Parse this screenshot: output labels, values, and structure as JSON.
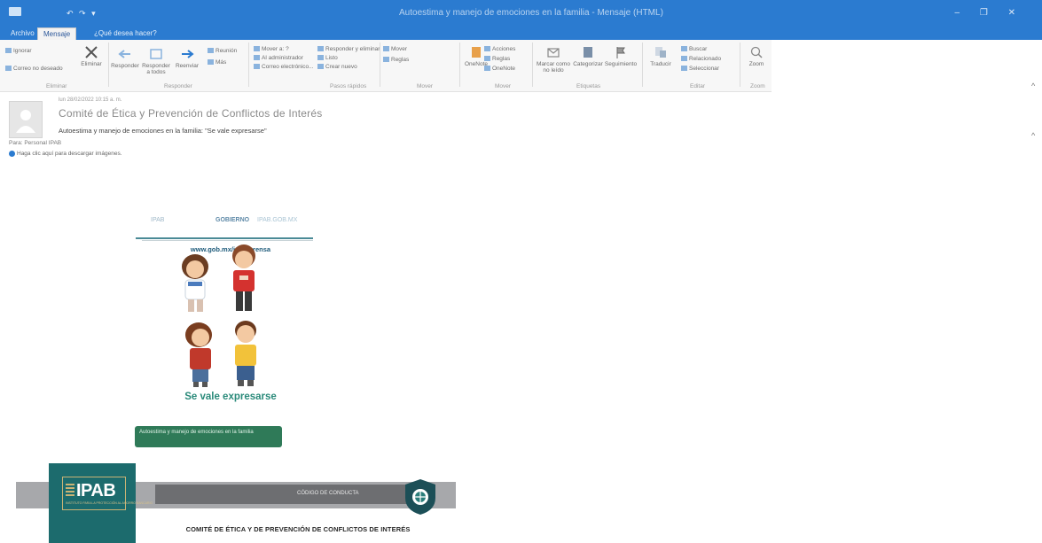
{
  "window": {
    "title": "Autoestima y manejo de emociones en la familia - Mensaje (HTML)",
    "controls": "–  ❐  ✕"
  },
  "tabs": [
    {
      "label": "Archivo"
    },
    {
      "label": "Mensaje"
    },
    {
      "label": "¿Qué desea hacer?"
    }
  ],
  "ribbon": {
    "groups": [
      {
        "label": "Eliminar"
      },
      {
        "label": "Responder"
      },
      {
        "label": "Pasos rápidos"
      },
      {
        "label": "Mover"
      },
      {
        "label": "Etiquetas"
      },
      {
        "label": "Editar"
      },
      {
        "label": "Zoom"
      }
    ],
    "buttons": {
      "ignore": "Ignorar",
      "junk": "Correo no deseado",
      "delete": "Eliminar",
      "reply": "Responder",
      "reply_all": "Responder a todos",
      "forward": "Reenviar",
      "meeting": "Reunión",
      "more": "Más",
      "move_to": "Mover a: ?",
      "to_manager": "Al administrador",
      "team_email": "Correo electrónico...",
      "reply_delete": "Responder y eliminar",
      "done": "Listo",
      "create_new": "Crear nuevo",
      "move": "Mover",
      "rules": "Reglas",
      "onenote": "OneNote",
      "actions": "Acciones",
      "mark_unread": "Marcar como no leído",
      "categorize": "Categorizar",
      "follow_up": "Seguimiento",
      "translate": "Traducir",
      "find": "Buscar",
      "related": "Relacionado",
      "select": "Seleccionar",
      "zoom": "Zoom"
    }
  },
  "message": {
    "date": "lun 28/02/2022 10:15 a. m.",
    "sender": "Comité de Ética y Prevención de Conflictos de Interés",
    "subject": "Autoestima y manejo de emociones en la familia: \"Se vale expresarse\"",
    "to": "Para: Personal IPAB",
    "info": "Haga clic aquí para descargar imágenes."
  },
  "body": {
    "banner_a": "IPAB",
    "banner_b": "GOBIERNO",
    "banner_c": "IPAB.GOB.MX",
    "website": "www.gob.mx/ipab/prensa",
    "slogan": "Se vale expresarse",
    "green_button": "Autoestima y manejo de emociones en la familia",
    "footer_dark": "CÓDIGO DE CONDUCTA",
    "ipab": "IPAB",
    "ipab_sub": "INSTITUTO PARA LA PROTECCIÓN AL AHORRO BANCARIO",
    "committee": "COMITÉ DE ÉTICA Y DE PREVENCIÓN DE CONFLICTOS DE INTERÉS"
  },
  "colors": {
    "titlebar": "#2b7bd0",
    "ribbon": "#f7f7f7",
    "teal": "#1c6b6d",
    "slogan": "#2a8a7a",
    "green_button": "#2f7a58"
  }
}
